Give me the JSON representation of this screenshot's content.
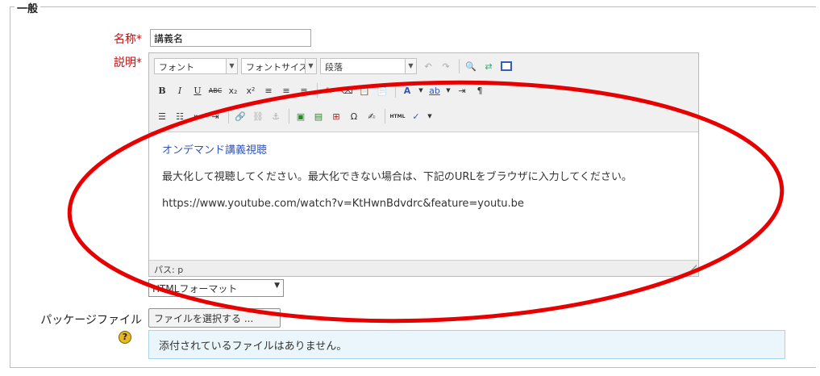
{
  "fieldset": {
    "legend": "一般"
  },
  "name_field": {
    "label": "名称",
    "required_mark": "*",
    "value": "講義名"
  },
  "description_field": {
    "label": "説明",
    "required_mark": "*"
  },
  "editor": {
    "toolbar_row1": {
      "font_select": "フォント",
      "size_select": "フォントサイズ",
      "paragraph_select": "段落"
    },
    "toolbar_row2": {
      "bold": "B",
      "italic": "I",
      "underline": "U",
      "strike": "ABC"
    },
    "toolbar_row3": {
      "html": "HTML"
    },
    "content": {
      "link_text": "オンデマンド講義視聴",
      "paragraph": "最大化して視聴してください。最大化できない場合は、下記のURLをブラウザに入力してください。",
      "url": "https://www.youtube.com/watch?v=KtHwnBdvdrc&feature=youtu.be"
    },
    "path_label": "パス: p"
  },
  "format_select": {
    "value": "HTMLフォーマット"
  },
  "package_file": {
    "label": "パッケージファイル",
    "button_label": "ファイルを選択する ...",
    "help_glyph": "?",
    "no_files_text": "添付されているファイルはありません。"
  },
  "colors": {
    "annotation_ellipse": "#e60000",
    "required": "#b51515",
    "info_bg": "#ebf6fc"
  }
}
